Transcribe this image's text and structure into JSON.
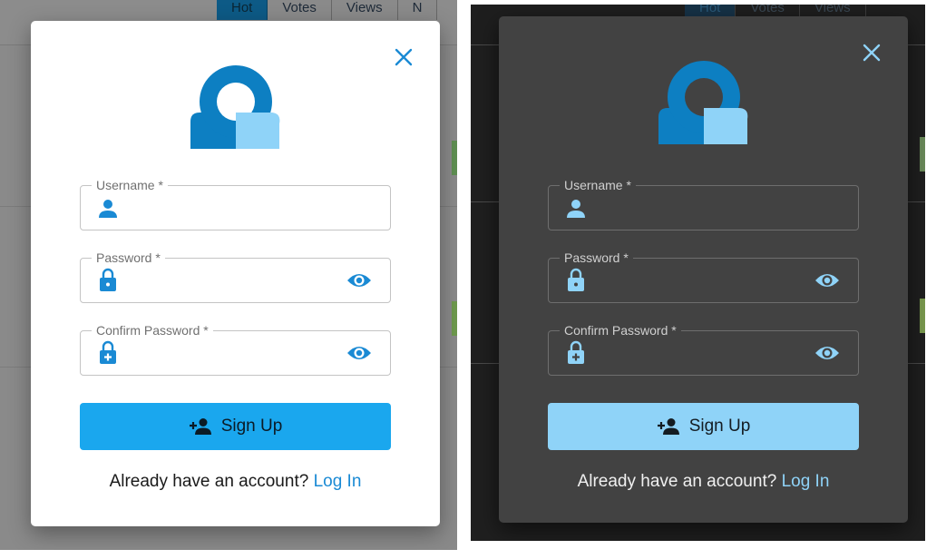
{
  "background": {
    "tabs": [
      "Hot",
      "Votes",
      "Views",
      "N"
    ],
    "active_tab": "Hot"
  },
  "dialog": {
    "username_label": "Username *",
    "password_label": "Password *",
    "confirm_password_label": "Confirm Password *",
    "signup_label": "Sign Up",
    "footer_prompt": "Already have an account? ",
    "login_link": "Log In"
  },
  "icons": {
    "close": "close-icon",
    "logo": "logo-icon",
    "username": "person-icon",
    "password": "lock-icon",
    "confirm_password": "lock-plus-icon",
    "visibility": "eye-icon",
    "signup": "person-add-icon"
  },
  "colors": {
    "accent_light": "#1aa7ee",
    "accent_dark": "#8fd3f8",
    "icon_light": "#1a8ad4",
    "icon_dark": "#8fd3f8",
    "logo_dark_blue": "#0d7fc2",
    "logo_light_blue": "#8fd3f8"
  }
}
